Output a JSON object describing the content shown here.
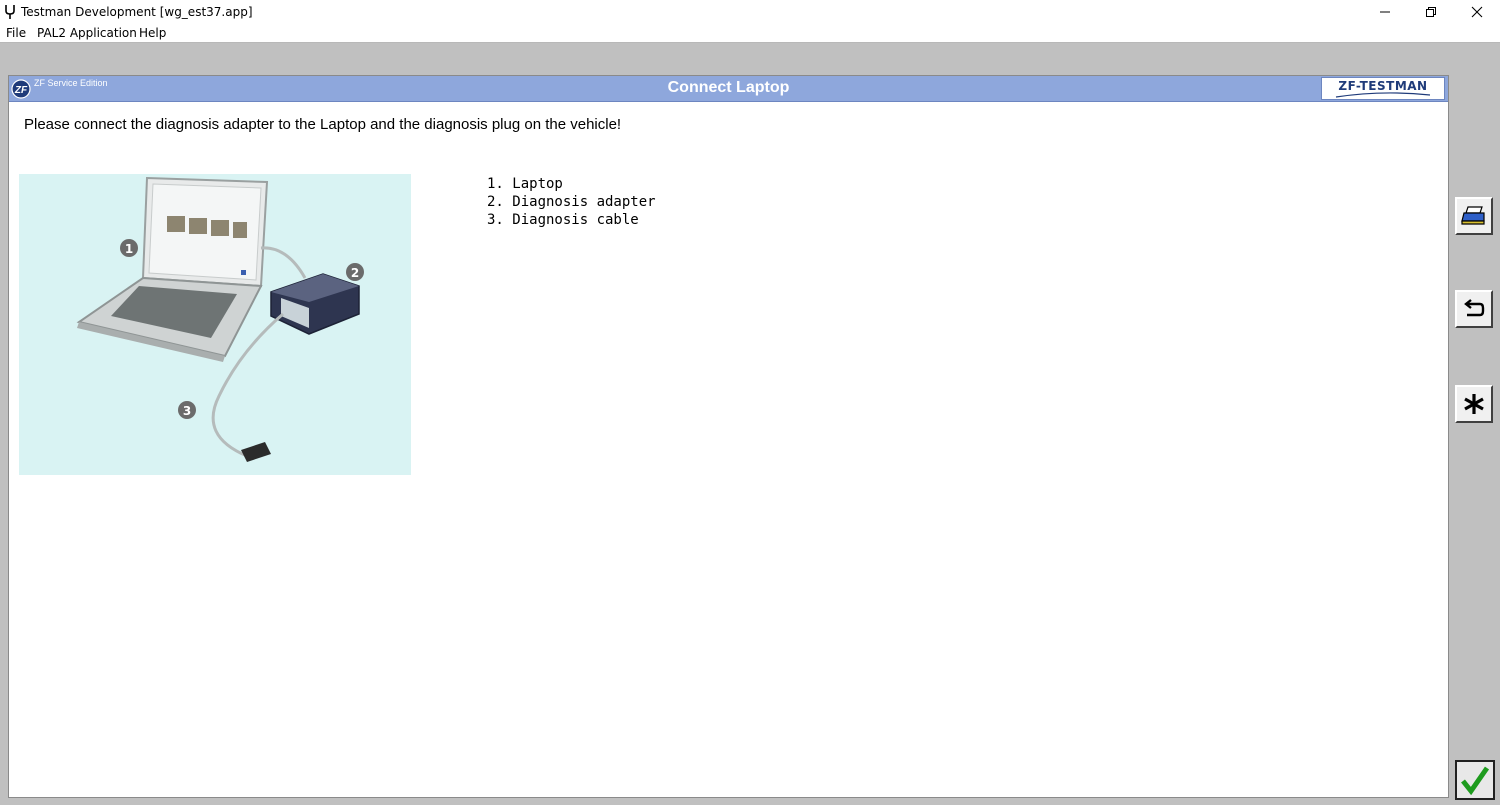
{
  "window": {
    "title": "Testman Development [wg_est37.app]",
    "icon": "tuning-fork-icon",
    "controls": [
      "minimize-icon",
      "maximize-icon",
      "close-icon"
    ]
  },
  "menu": {
    "items": [
      "File",
      "PAL2 Application",
      "Help"
    ]
  },
  "header": {
    "edition": "ZF Service Edition",
    "title": "Connect Laptop",
    "logo_text": "ZF-TESTMAN",
    "bar_color": "#8ea7dc"
  },
  "content": {
    "instruction": "Please connect the diagnosis adapter to the Laptop and the diagnosis plug on the vehicle!",
    "legend": [
      "1. Laptop",
      "2. Diagnosis adapter",
      "3. Diagnosis cable"
    ],
    "callouts": [
      "1",
      "2",
      "3"
    ]
  },
  "side_buttons": {
    "print": "printer-icon",
    "back": "return-arrow-icon",
    "star": "asterisk-icon",
    "ok": "checkmark-icon",
    "ok_color": "#1e9b1e"
  }
}
